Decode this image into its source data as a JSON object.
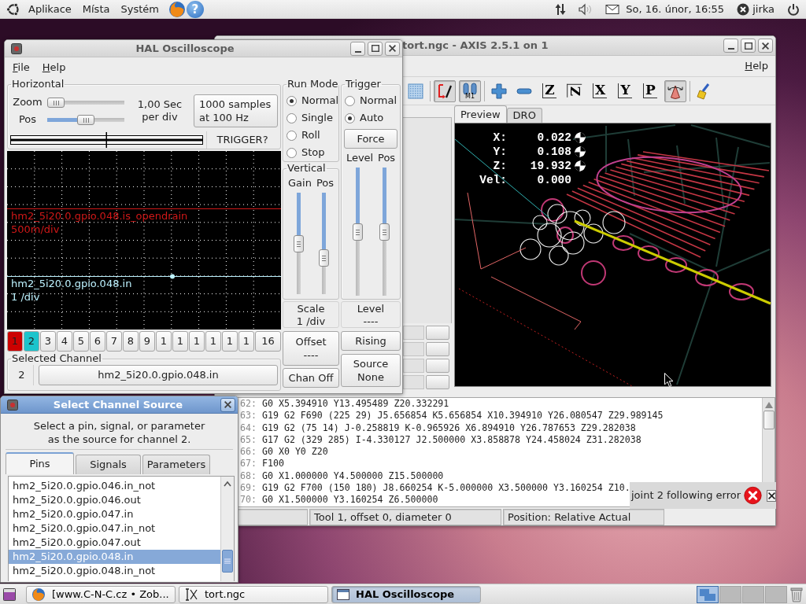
{
  "top_panel": {
    "menus": [
      "Aplikace",
      "Místa",
      "Systém"
    ],
    "help_glyph": "?",
    "clock": "So, 16. únor, 16:55",
    "user": "jirka"
  },
  "axis_window": {
    "title": "tort.ngc - AXIS 2.5.1 on 1",
    "menu": [
      "Help"
    ],
    "toolbar": [
      {
        "kind": "frame",
        "pressed": false
      },
      {
        "kind": "separator"
      },
      {
        "kind": "toolpath",
        "pressed": true
      },
      {
        "kind": "mstop",
        "label": "M1",
        "pressed": true
      },
      {
        "kind": "separator"
      },
      {
        "kind": "zoomin",
        "pressed": false
      },
      {
        "kind": "zoomout",
        "pressed": false
      },
      {
        "kind": "view",
        "label": "Z",
        "pressed": false
      },
      {
        "kind": "rotview",
        "label": "Z",
        "pressed": false
      },
      {
        "kind": "view",
        "label": "X",
        "pressed": false
      },
      {
        "kind": "view",
        "label": "Y",
        "pressed": false
      },
      {
        "kind": "view",
        "label": "P",
        "pressed": false
      },
      {
        "kind": "perspective",
        "pressed": true
      },
      {
        "kind": "separator"
      },
      {
        "kind": "clear",
        "pressed": false
      }
    ],
    "tabs": [
      {
        "label": "Preview",
        "selected": true
      },
      {
        "label": "DRO",
        "selected": false
      }
    ],
    "dro": {
      "axes": [
        {
          "label": "X:",
          "value": "0.022",
          "homed": true
        },
        {
          "label": "Y:",
          "value": "0.108",
          "homed": true
        },
        {
          "label": "Z:",
          "value": "19.932",
          "homed": true
        }
      ],
      "velocity": {
        "label": "Vel:",
        "value": "0.000"
      }
    },
    "code_lines": [
      {
        "number": "62:",
        "text": "G0 X5.394910 Y13.495489 Z20.332291"
      },
      {
        "number": "63:",
        "text": "G19 G2 F690 (225 29) J5.656854 K5.656854 X10.394910 Y26.080547 Z29.989145"
      },
      {
        "number": "64:",
        "text": "G19 G2 (75 14) J-0.258819 K-0.965926 X6.894910 Y26.787653 Z29.282038"
      },
      {
        "number": "65:",
        "text": "G17 G2 (329 285) I-4.330127 J2.500000 X3.858878 Y24.458024 Z31.282038"
      },
      {
        "number": "66:",
        "text": "G0 X0 Y0 Z20"
      },
      {
        "number": "67:",
        "text": "F100"
      },
      {
        "number": "68:",
        "text": "G0 X1.000000 Y4.500000 Z15.500000"
      },
      {
        "number": "69:",
        "text": "G19 G2 F700 (150 180) J8.660254 K-5.000000 X3.500000 Y3.160254 Z10."
      },
      {
        "number": "70:",
        "text": "G0 X1.500000 Y3.160254 Z6.500000"
      }
    ],
    "status": [
      "Tool 1, offset 0, diameter 0",
      "Position: Relative Actual"
    ],
    "notification": {
      "kind": "error",
      "message": "joint 2 following error"
    }
  },
  "oscilloscope": {
    "title": "HAL Oscilloscope",
    "menu": [
      "File",
      "Help"
    ],
    "horizontal": {
      "title": "Horizontal",
      "zoom_label": "Zoom",
      "zoom": {
        "level": 0
      },
      "pos_label": "Pos",
      "pos": {
        "level": 0.5
      },
      "rate": "1,00 Sec per div",
      "samples": "1000 samples at 100 Hz",
      "buffer": {
        "level": 0.5
      },
      "trigger_state": "TRIGGER?"
    },
    "run_mode": {
      "title": "Run Mode",
      "options": [
        {
          "label": "Normal",
          "selected": true
        },
        {
          "label": "Single",
          "selected": false
        },
        {
          "label": "Roll",
          "selected": false
        },
        {
          "label": "Stop",
          "selected": false
        }
      ]
    },
    "vertical": {
      "title": "Vertical",
      "gain_label": "Gain",
      "pos_label": "Pos",
      "gain": {
        "level": 0.5
      },
      "pos": {
        "level": 0.67
      },
      "scale_label": "Scale",
      "scale": "1 /div",
      "offset_label": "Offset",
      "offset": "----",
      "chan_off": "Chan Off"
    },
    "trigger": {
      "title": "Trigger",
      "options": [
        {
          "label": "Normal",
          "selected": false
        },
        {
          "label": "Auto",
          "selected": true
        }
      ],
      "force": "Force",
      "level_label": "Level",
      "pos_label": "Pos",
      "level": {
        "level": 0.5
      },
      "pos": {
        "level": 0.5
      },
      "readout_label": "Level",
      "readout": "----",
      "edge": "Rising",
      "source_label": "Source",
      "source": "None"
    },
    "traces": [
      {
        "name": "hm2_5i20.0.gpio.048.is_opendrain",
        "scale": "500m/div",
        "color": "#d01818"
      },
      {
        "name": "hm2_5i20.0.gpio.048.in",
        "scale": "1 /div",
        "color": "#bdf2ff"
      }
    ],
    "channels": [
      {
        "label": "1",
        "color": "#cc0000"
      },
      {
        "label": "2",
        "color": "#1cc4cc"
      },
      {
        "label": "3"
      },
      {
        "label": "4"
      },
      {
        "label": "5"
      },
      {
        "label": "6"
      },
      {
        "label": "7"
      },
      {
        "label": "8"
      },
      {
        "label": "9"
      },
      {
        "label": "1"
      },
      {
        "label": "1"
      },
      {
        "label": "1"
      },
      {
        "label": "1"
      },
      {
        "label": "1"
      },
      {
        "label": "1"
      },
      {
        "label": "16"
      }
    ],
    "selected_channel": {
      "title": "Selected Channel",
      "number": "2",
      "source": "hm2_5i20.0.gpio.048.in"
    }
  },
  "source_dialog": {
    "title": "Select Channel Source",
    "prompt": "Select a pin, signal, or parameter as the source for channel 2.",
    "tabs": [
      {
        "label": "Pins",
        "selected": true
      },
      {
        "label": "Signals",
        "selected": false
      },
      {
        "label": "Parameters",
        "selected": false
      }
    ],
    "items": [
      {
        "label": "hm2_5i20.0.gpio.046.in_not",
        "selected": false
      },
      {
        "label": "hm2_5i20.0.gpio.046.out",
        "selected": false
      },
      {
        "label": "hm2_5i20.0.gpio.047.in",
        "selected": false
      },
      {
        "label": "hm2_5i20.0.gpio.047.in_not",
        "selected": false
      },
      {
        "label": "hm2_5i20.0.gpio.047.out",
        "selected": false
      },
      {
        "label": "hm2_5i20.0.gpio.048.in",
        "selected": true
      },
      {
        "label": "hm2_5i20.0.gpio.048.in_not",
        "selected": false
      }
    ]
  },
  "taskbar": {
    "tasks": [
      {
        "kind": "browser",
        "label": "[www.C-N-C.cz • Zob...",
        "active": false
      },
      {
        "kind": "cnc",
        "label": "tort.ngc",
        "active": false
      },
      {
        "kind": "window",
        "label": "HAL Oscilloscope",
        "active": true
      }
    ],
    "workspaces": [
      {
        "selected": true
      },
      {
        "selected": false
      },
      {
        "selected": false
      },
      {
        "selected": false
      }
    ]
  }
}
